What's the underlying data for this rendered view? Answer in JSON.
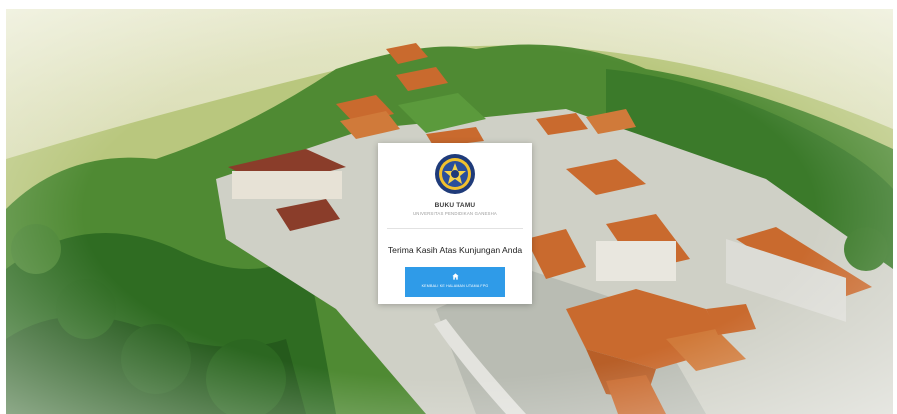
{
  "background": {
    "description_icon": "campus-aerial-illustration",
    "colors": {
      "sky": "#d9ddb6",
      "forest": "#3f7d2c",
      "roof": "#c96a2e"
    }
  },
  "card": {
    "logo_icon": "university-crest-icon",
    "title": "BUKU TAMU",
    "subtitle": "UNIVERSITAS PENDIDIKAN GANESHA",
    "message": "Terima Kasih Atas Kunjungan Anda",
    "button": {
      "icon": "home-icon",
      "label": "KEMBALI KE HALAMAN UTAMA FPG",
      "color": "#2f9be8"
    }
  }
}
